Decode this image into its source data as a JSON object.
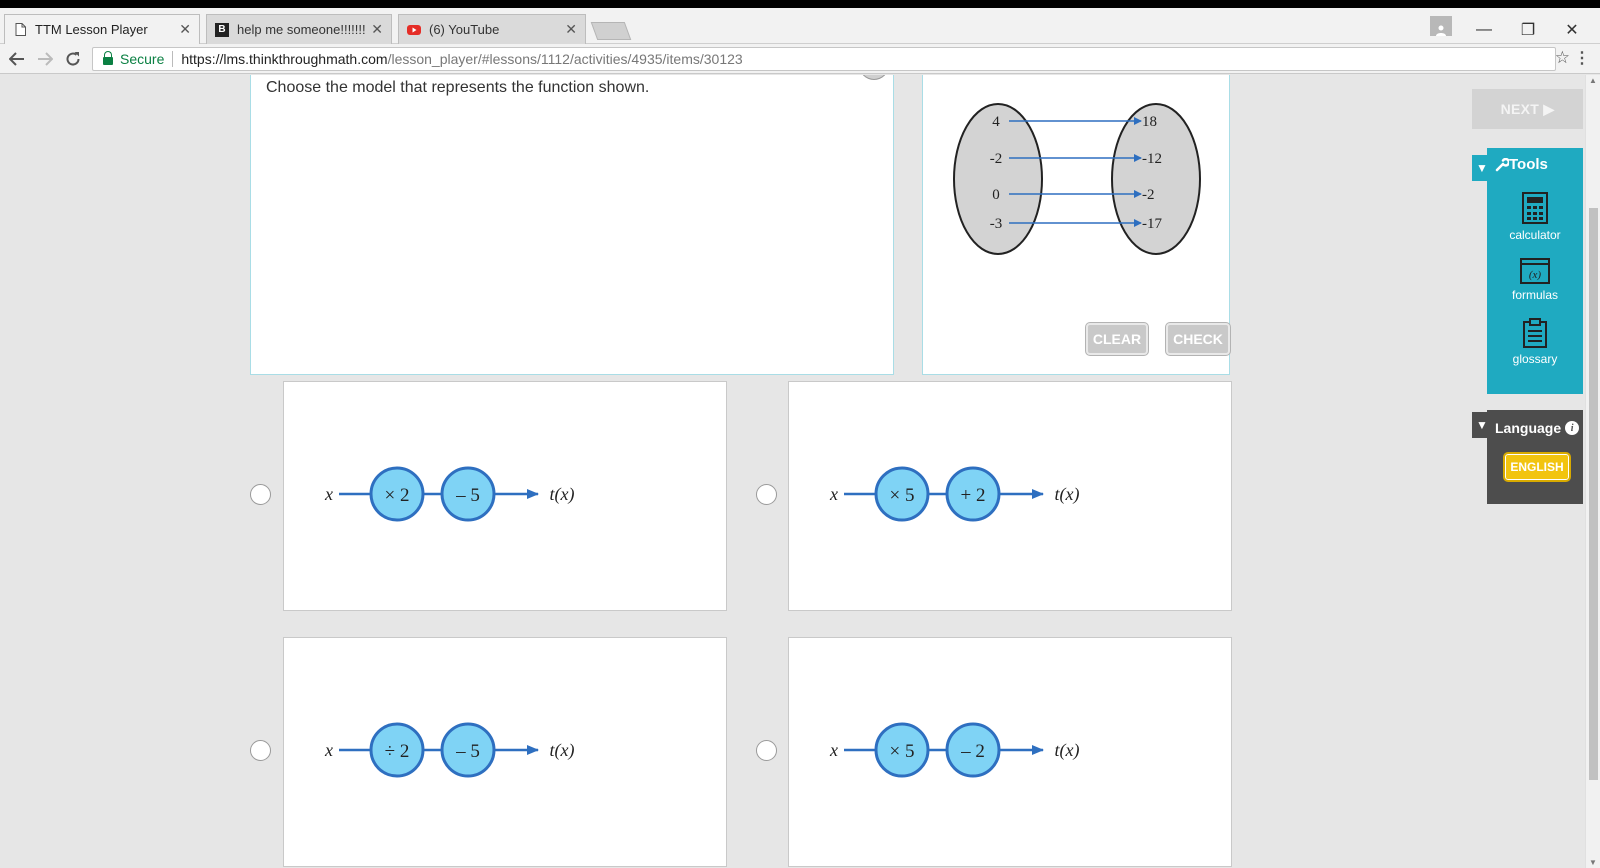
{
  "browser": {
    "tabs": [
      {
        "title": "TTM Lesson Player",
        "active": true,
        "favicon": "document-icon"
      },
      {
        "title": "help me someone!!!!!!!!",
        "active": false,
        "favicon": "brainly-icon"
      },
      {
        "title": "(6) YouTube",
        "active": false,
        "favicon": "youtube-icon"
      }
    ],
    "tab_close": "✕",
    "window_controls": {
      "minimize": "—",
      "restore": "❐",
      "close": "✕"
    },
    "secure_label": "Secure",
    "url_host": "https://lms.thinkthroughmath.com",
    "url_path": "/lesson_player/#lessons/1112/activities/4935/items/30123"
  },
  "question": {
    "prompt": "Choose the model that represents the function shown."
  },
  "mapping": {
    "inputs": [
      "4",
      "-2",
      "0",
      "-3"
    ],
    "outputs": [
      "18",
      "-12",
      "-2",
      "-17"
    ]
  },
  "buttons": {
    "clear": "CLEAR",
    "check": "CHECK",
    "next": "NEXT ▶"
  },
  "options": [
    {
      "input": "x",
      "op1": "× 2",
      "op2": "– 5",
      "output": "t(x)"
    },
    {
      "input": "x",
      "op1": "× 5",
      "op2": "+ 2",
      "output": "t(x)"
    },
    {
      "input": "x",
      "op1": "÷ 2",
      "op2": "– 5",
      "output": "t(x)"
    },
    {
      "input": "x",
      "op1": "× 5",
      "op2": "– 2",
      "output": "t(x)"
    }
  ],
  "sidebar": {
    "tools_title": "Tools",
    "tools": [
      {
        "label": "calculator",
        "icon": "calculator-icon"
      },
      {
        "label": "formulas",
        "icon": "formulas-icon"
      },
      {
        "label": "glossary",
        "icon": "glossary-icon"
      }
    ],
    "language_title": "Language",
    "language_button": "ENGLISH",
    "toggle_glyph": "▼",
    "info_glyph": "i"
  },
  "colors": {
    "tools_panel": "#1faac1",
    "language_panel": "#4d4d4d",
    "language_button": "#f2c40f",
    "node_fill": "#7fd3f5",
    "node_stroke": "#2e6fc0",
    "mapping_oval": "#d3d3d3"
  }
}
